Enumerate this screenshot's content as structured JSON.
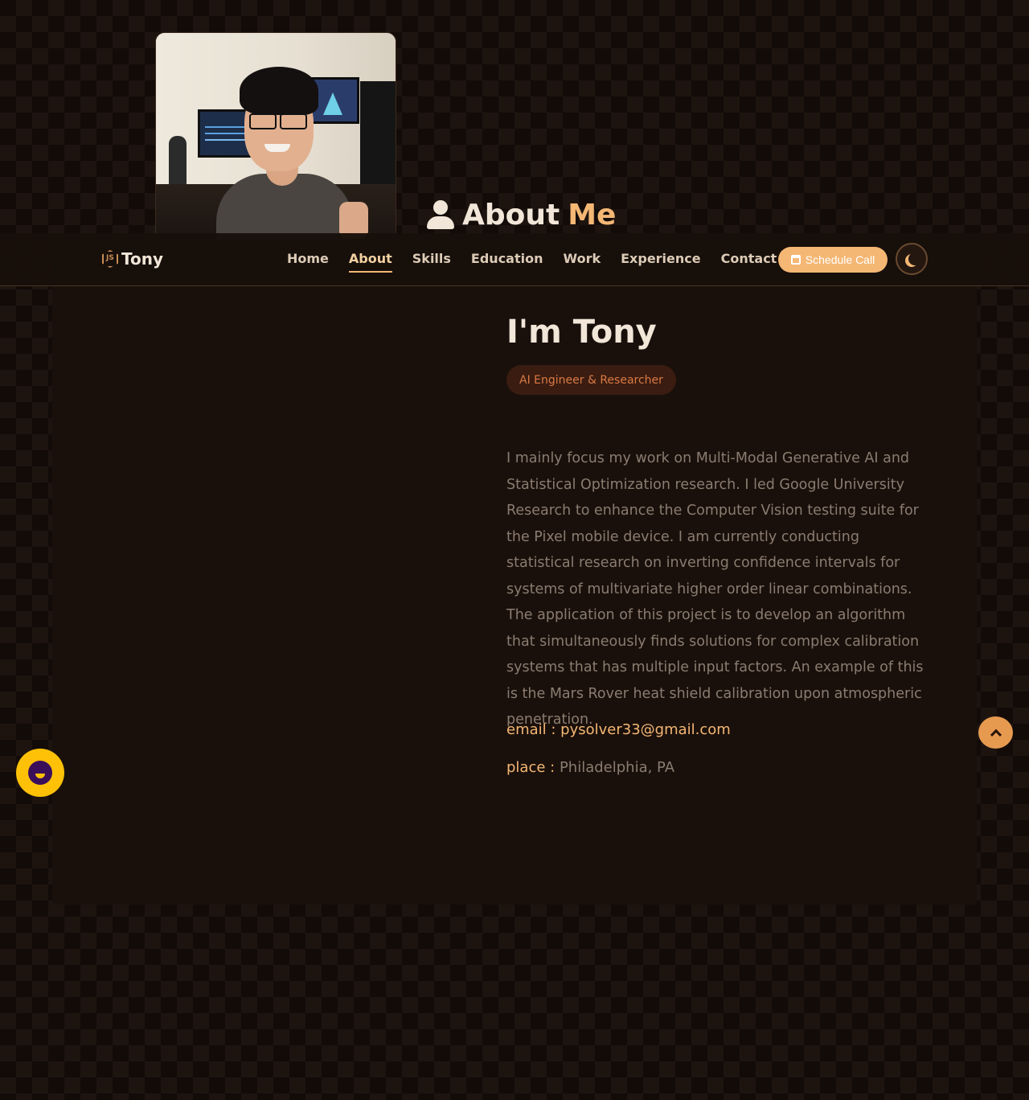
{
  "section": {
    "title_main": "About",
    "title_accent": "Me"
  },
  "navbar": {
    "brand": "Tony",
    "links": [
      "Home",
      "About",
      "Skills",
      "Education",
      "Work",
      "Experience",
      "Contact"
    ],
    "active": "About",
    "schedule_label": "Schedule Call"
  },
  "about": {
    "heading": "I'm Tony",
    "role": "AI Engineer & Researcher",
    "bio": "I mainly focus my work on Multi-Modal Generative AI and Statistical Optimization research. I led Google University Research to enhance the Computer Vision testing suite for the Pixel mobile device. I am currently conducting statistical research on inverting confidence intervals for systems of multivariate higher order linear combinations. The application of this project is to develop an algorithm that simultaneously finds solutions for complex calibration systems that has multiple input factors. An example of this is the Mars Rover heat shield calibration upon atmospheric penetration.",
    "email_label": "email :",
    "email": "pysolver33@gmail.com",
    "place_label": "place :",
    "place": "Philadelphia, PA"
  },
  "icons": {
    "user": "user-icon",
    "calendar": "calendar-icon",
    "theme": "moon-icon",
    "scroll_top": "chevron-up-icon",
    "chat": "chat-icon"
  },
  "colors": {
    "accent": "#f4b774",
    "background": "#130b08",
    "chat": "#ffc107"
  }
}
